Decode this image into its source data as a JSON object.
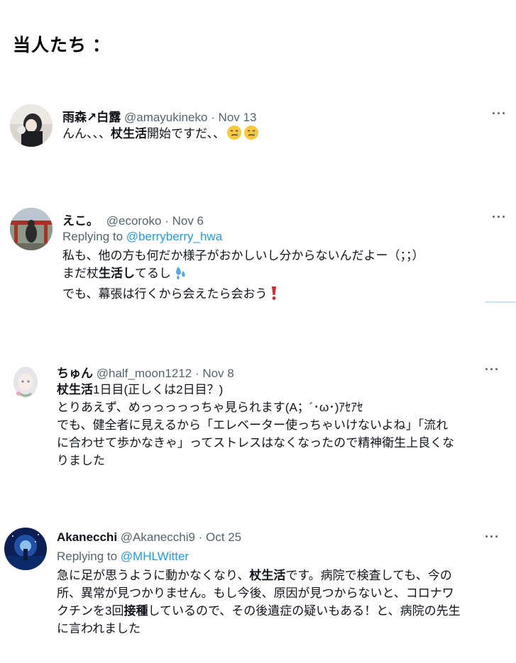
{
  "heading": "当人たち ：",
  "tweets": [
    {
      "display_name": "雨森↗白露",
      "handle": "@amayukineko",
      "date": "· Nov 13",
      "more": "···",
      "lines": [
        {
          "parts": [
            {
              "t": "んん、、、"
            },
            {
              "t": "杖生活",
              "b": true
            },
            {
              "t": "開始ですだ、、"
            }
          ],
          "emoji": [
            "crying-face",
            "crying-face"
          ]
        }
      ]
    },
    {
      "display_name": "えこ。",
      "handle": "@ecoroko",
      "date": "· Nov 6",
      "more": "···",
      "replying_prefix": "Replying to ",
      "replying_to": "@berryberry_hwa",
      "lines": [
        {
          "parts": [
            {
              "t": "私も、他の方も何だか様子がおかしいし分からないんだよー（；；）"
            }
          ]
        },
        {
          "parts": [
            {
              "t": "まだ杖"
            },
            {
              "t": "生活し",
              "b": true
            },
            {
              "t": "てるし"
            }
          ],
          "emoji": [
            "sweat-droplets"
          ]
        },
        {
          "parts": [
            {
              "t": "でも、幕張は行くから会えたら会おう"
            }
          ],
          "emoji": [
            "exclamation"
          ]
        }
      ]
    },
    {
      "display_name": "ちゅん",
      "handle": "@half_moon1212",
      "date": "· Nov 8",
      "more": "···",
      "lines": [
        {
          "parts": [
            {
              "t": "杖生活",
              "b": true
            },
            {
              "t": "1日目(正しくは2日目？)"
            }
          ]
        },
        {
          "parts": [
            {
              "t": "とりあえず、めっっっっっちゃ見られます(A；´･ω･)ｱｾｱｾ"
            }
          ]
        },
        {
          "parts": [
            {
              "t": "でも、健全者に見えるから「エレベーター使っちゃいけないよね」「流れ"
            }
          ]
        },
        {
          "parts": [
            {
              "t": "に合わせて歩かなきゃ」ってストレスはなくなったので精神衛生上良くな"
            }
          ]
        },
        {
          "parts": [
            {
              "t": "りました"
            }
          ]
        }
      ]
    },
    {
      "display_name": "Akanecchi",
      "handle": "@Akanecchi9",
      "date": "· Oct 25",
      "more": "···",
      "replying_prefix": "Replying to ",
      "replying_to": "@MHLWitter",
      "lines": [
        {
          "parts": [
            {
              "t": "急に足が思うように動かなくなり、"
            },
            {
              "t": "杖生活",
              "b": true
            },
            {
              "t": "です。病院で検査しても、今の"
            }
          ]
        },
        {
          "parts": [
            {
              "t": "所、異常が見つかりません。もし今後、原因が見つからないと、コロナワ"
            }
          ]
        },
        {
          "parts": [
            {
              "t": "クチンを3回"
            },
            {
              "t": "接種",
              "b": true
            },
            {
              "t": "しているので、その後遺症の疑いもある！と、病院の先生"
            }
          ]
        },
        {
          "parts": [
            {
              "t": "に言われました"
            }
          ]
        }
      ]
    }
  ]
}
